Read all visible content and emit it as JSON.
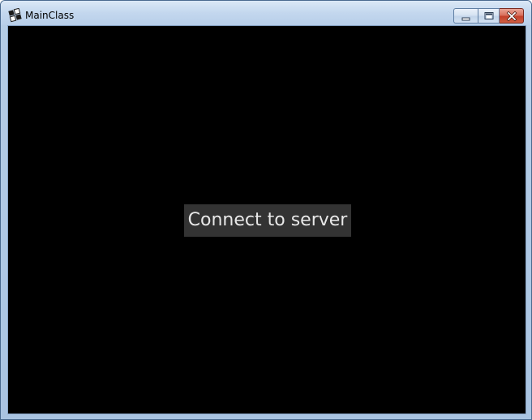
{
  "window": {
    "title": "MainClass",
    "app_icon": "java-app-icon",
    "controls": {
      "minimize_icon": "minimize-icon",
      "maximize_icon": "maximize-icon",
      "close_icon": "close-icon"
    }
  },
  "main": {
    "background_color": "#000000",
    "connect_button_label": "Connect to server",
    "connect_button_color": "#333333"
  }
}
